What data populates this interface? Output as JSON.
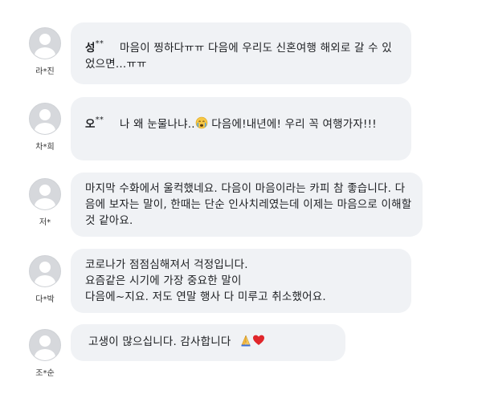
{
  "comments": [
    {
      "author_label": "라*진",
      "name": "성",
      "name_mask": "**",
      "text": "마음이 찡하다ㅠㅠ 다음에 우리도 신혼여행 해외로 갈 수 있었으면...ㅠㅠ"
    },
    {
      "author_label": "차*희",
      "name": "오",
      "name_mask": "**",
      "text_before_emoji": "나 왜 눈물나냐..",
      "emoji": "crying-face",
      "text_after_emoji": "다음에!내년에! 우리 꼭 여행가자!!!"
    },
    {
      "author_label": "저*",
      "text": "마지막 수화에서 울컥했네요. 다음이 마음이라는 카피 참 좋습니다. 다음에 보자는 말이, 한때는 단순 인사치레였는데 이제는 마음으로 이해할 것 같아요."
    },
    {
      "author_label": "다*박",
      "lines": [
        "코로나가 점점심해져서 걱정입니다.",
        "요즘같은 시기에 가장 중요한 말이",
        "다음에~지요. 저도 연말 행사 다 미루고 취소했어요."
      ]
    },
    {
      "author_label": "조*순",
      "text": "고생이 많으십니다. 감사합니다",
      "emoji_1": "folded-hands",
      "emoji_2": "red-heart"
    }
  ],
  "colors": {
    "bubble": "#f0f2f5",
    "avatar": "#d6d8dc",
    "text": "#1c1e21"
  }
}
